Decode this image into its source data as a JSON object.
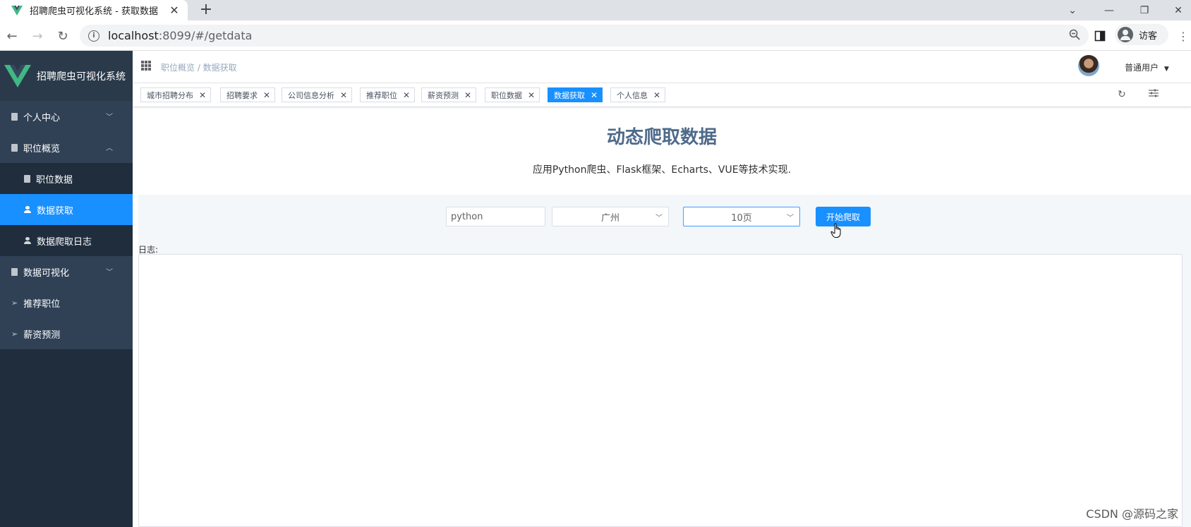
{
  "browser": {
    "tab_title": "招聘爬虫可视化系统 - 获取数据",
    "url_host": "localhost",
    "url_rest": ":8099/#/getdata",
    "guest_label": "访客"
  },
  "sidebar": {
    "app_title": "招聘爬虫可视化系统",
    "items": [
      {
        "label": "个人中心",
        "icon": "document-icon",
        "level": "top",
        "chevron": "down"
      },
      {
        "label": "职位概览",
        "icon": "document-icon",
        "level": "top",
        "chevron": "up"
      },
      {
        "label": "职位数据",
        "icon": "document-icon",
        "level": "sub"
      },
      {
        "label": "数据获取",
        "icon": "user-icon",
        "level": "sub",
        "active": true
      },
      {
        "label": "数据爬取日志",
        "icon": "user-icon",
        "level": "sub"
      },
      {
        "label": "数据可视化",
        "icon": "document-icon",
        "level": "top",
        "chevron": "down"
      },
      {
        "label": "推荐职位",
        "icon": "send-icon",
        "level": "top"
      },
      {
        "label": "薪资预测",
        "icon": "send-icon",
        "level": "top"
      }
    ]
  },
  "header": {
    "breadcrumb": "职位概览 / 数据获取",
    "user_menu": "普通用户"
  },
  "tags": [
    {
      "label": "城市招聘分布"
    },
    {
      "label": "招聘要求"
    },
    {
      "label": "公司信息分析"
    },
    {
      "label": "推荐职位"
    },
    {
      "label": "薪资预测"
    },
    {
      "label": "职位数据"
    },
    {
      "label": "数据获取",
      "active": true
    },
    {
      "label": "个人信息"
    }
  ],
  "content": {
    "title": "动态爬取数据",
    "subtitle": "应用Python爬虫、Flask框架、Echarts、VUE等技术实现.",
    "keyword_value": "python",
    "city_value": "广州",
    "pages_value": "10页",
    "start_button": "开始爬取",
    "log_label": "日志:"
  },
  "watermark": "CSDN @源码之家",
  "colors": {
    "accent": "#1890ff",
    "sidebar_bg": "#304156",
    "sidebar_dark": "#1f2d3d",
    "title": "#4e6a8a"
  }
}
